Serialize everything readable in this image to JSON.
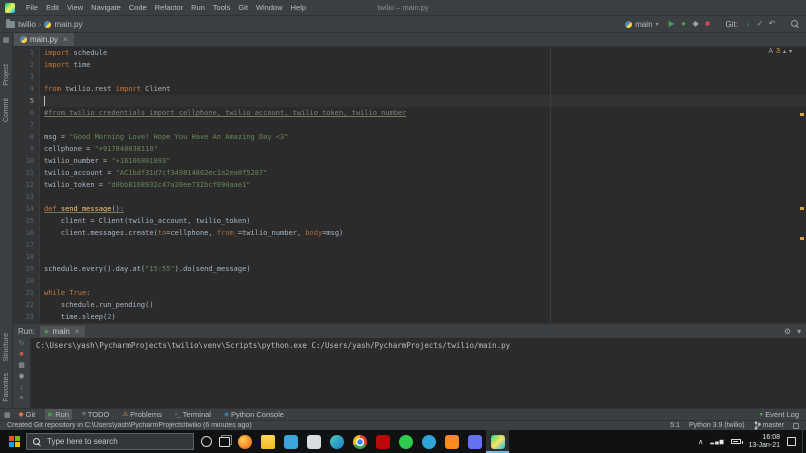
{
  "window": {
    "title": "twilio – main.py"
  },
  "colors": {
    "window_bg": "#3c3f41",
    "editor_bg": "#2b2b2b",
    "gutter_text": "#606366",
    "text": "#a9b7c6",
    "keyword": "#cc7832",
    "string": "#6a8759",
    "comment": "#808080",
    "number": "#6897bb",
    "function": "#ffc66d",
    "keyword_argument": "#ad6a3e",
    "caret_line": "#323232",
    "active_tab": "#4e5254",
    "run_green": "#499c54",
    "stop_red": "#c75450",
    "warning_yellow": "#d9a343",
    "taskbar_bg": "#0f1112"
  },
  "menubar": {
    "items": [
      "File",
      "Edit",
      "View",
      "Navigate",
      "Code",
      "Refactor",
      "Run",
      "Tools",
      "Git",
      "Window",
      "Help"
    ]
  },
  "navbar": {
    "breadcrumbs": [
      "twilio",
      "main.py"
    ],
    "run_config": "main",
    "git_label": "Git:",
    "actions": [
      "run-button",
      "debug-button",
      "coverage-button",
      "stop-button"
    ],
    "git_actions": [
      "update-project-button",
      "commit-button",
      "rollback-button"
    ]
  },
  "editor_tabs": [
    {
      "label": "main.py"
    }
  ],
  "editor": {
    "caret_line": 5,
    "inspections": {
      "label": "A",
      "count": "3"
    },
    "lines": [
      {
        "n": 1,
        "t": [
          [
            "kw",
            "import"
          ],
          [
            "pl",
            " schedule"
          ]
        ]
      },
      {
        "n": 2,
        "t": [
          [
            "kw",
            "import"
          ],
          [
            "pl",
            " time"
          ]
        ]
      },
      {
        "n": 3,
        "t": []
      },
      {
        "n": 4,
        "t": [
          [
            "kw",
            "from"
          ],
          [
            "pl",
            " twilio.rest "
          ],
          [
            "kw",
            "import"
          ],
          [
            "pl",
            " Client"
          ]
        ]
      },
      {
        "n": 5,
        "t": []
      },
      {
        "n": 6,
        "t": [
          [
            "cm u",
            "#from twilio_credentials import cellphone, twilio_account, twilio_token, twilio_number"
          ]
        ]
      },
      {
        "n": 7,
        "t": []
      },
      {
        "n": 8,
        "t": [
          [
            "pl",
            "msg = "
          ],
          [
            "st",
            "\"Good Morning Love! Hope You Have An Amazing Day <3\""
          ]
        ]
      },
      {
        "n": 9,
        "t": [
          [
            "pl",
            "cellphone = "
          ],
          [
            "st",
            "\"+917840038110\""
          ]
        ]
      },
      {
        "n": 10,
        "t": [
          [
            "pl",
            "twilio_number = "
          ],
          [
            "st",
            "\"+16106801093\""
          ]
        ]
      },
      {
        "n": 11,
        "t": [
          [
            "pl",
            "twilio_account = "
          ],
          [
            "st",
            "\"AC1bdf31d7cf349814862ec1a2ea0f5287\""
          ]
        ]
      },
      {
        "n": 12,
        "t": [
          [
            "pl",
            "twilio_token = "
          ],
          [
            "st",
            "\"d0bb8168932c47a20ee732bcf090aae1\""
          ]
        ]
      },
      {
        "n": 13,
        "t": []
      },
      {
        "n": 14,
        "t": [
          [
            "kw u",
            "def"
          ],
          [
            "fn u",
            " send_message"
          ],
          [
            "pl u",
            "():"
          ]
        ]
      },
      {
        "n": 15,
        "t": [
          [
            "pl",
            "    client = Client(twilio_account, twilio_token)"
          ]
        ]
      },
      {
        "n": 16,
        "t": [
          [
            "pl",
            "    client.messages.create("
          ],
          [
            "ar",
            "to"
          ],
          [
            "pl",
            "=cellphone, "
          ],
          [
            "ar",
            "from_"
          ],
          [
            "pl",
            "=twilio_number, "
          ],
          [
            "ar",
            "body"
          ],
          [
            "pl",
            "=msg)"
          ]
        ]
      },
      {
        "n": 17,
        "t": []
      },
      {
        "n": 18,
        "t": []
      },
      {
        "n": 19,
        "t": [
          [
            "pl",
            "schedule.every().day.at("
          ],
          [
            "st",
            "\"15:55\""
          ],
          [
            "pl",
            ").do(send_message)"
          ]
        ]
      },
      {
        "n": 20,
        "t": []
      },
      {
        "n": 21,
        "t": [
          [
            "kw",
            "while"
          ],
          [
            "pl",
            " "
          ],
          [
            "kw",
            "True"
          ],
          [
            "pl",
            ":"
          ]
        ]
      },
      {
        "n": 22,
        "t": [
          [
            "pl",
            "    schedule.run_pending()"
          ]
        ]
      },
      {
        "n": 23,
        "t": [
          [
            "pl",
            "    time.sleep("
          ],
          [
            "nu",
            "2"
          ],
          [
            "pl",
            ")"
          ]
        ]
      }
    ]
  },
  "run_panel": {
    "title": "Run:",
    "tab": "main",
    "toolbar": [
      "rerun-button",
      "stop-button",
      "restore-layout-button",
      "pin-tab-button",
      "scroll-to-end-button",
      "clear-console-button"
    ],
    "console_lines": [
      "C:\\Users\\yash\\PycharmProjects\\twilio\\venv\\Scripts\\python.exe C:/Users/yash/PycharmProjects/twilio/main.py"
    ]
  },
  "tool_window_bar": {
    "left": [
      {
        "label": "Git",
        "icon": "git"
      },
      {
        "label": "Run",
        "icon": "run",
        "active": true
      },
      {
        "label": "TODO",
        "icon": "todo"
      },
      {
        "label": "Problems",
        "icon": "problems"
      },
      {
        "label": "Terminal",
        "icon": "terminal"
      },
      {
        "label": "Python Console",
        "icon": "python"
      }
    ],
    "right": [
      {
        "label": "Event Log",
        "icon": "event"
      }
    ]
  },
  "status_bar": {
    "message": "Created Git repository in C:\\Users\\yash\\PycharmProjects\\twilio (6 minutes ago)",
    "caret_position": "5:1",
    "interpreter": "Python 3.9 (twilio)",
    "branch": "master"
  },
  "sidebars": {
    "left_top": [
      "Project",
      "Commit"
    ],
    "left_bottom": [
      "Structure",
      "Favorites"
    ]
  },
  "taskbar": {
    "search_placeholder": "Type here to search",
    "apps": [
      {
        "name": "firefox"
      },
      {
        "name": "file-explorer"
      },
      {
        "name": "microsoft-store"
      },
      {
        "name": "mail"
      },
      {
        "name": "microsoft-edge"
      },
      {
        "name": "chrome"
      },
      {
        "name": "netflix"
      },
      {
        "name": "whatsapp"
      },
      {
        "name": "telegram"
      },
      {
        "name": "vlc"
      },
      {
        "name": "discord"
      },
      {
        "name": "pycharm",
        "active": true
      }
    ],
    "tray": {
      "time": "16:08",
      "date": "13-Jan-21"
    }
  }
}
